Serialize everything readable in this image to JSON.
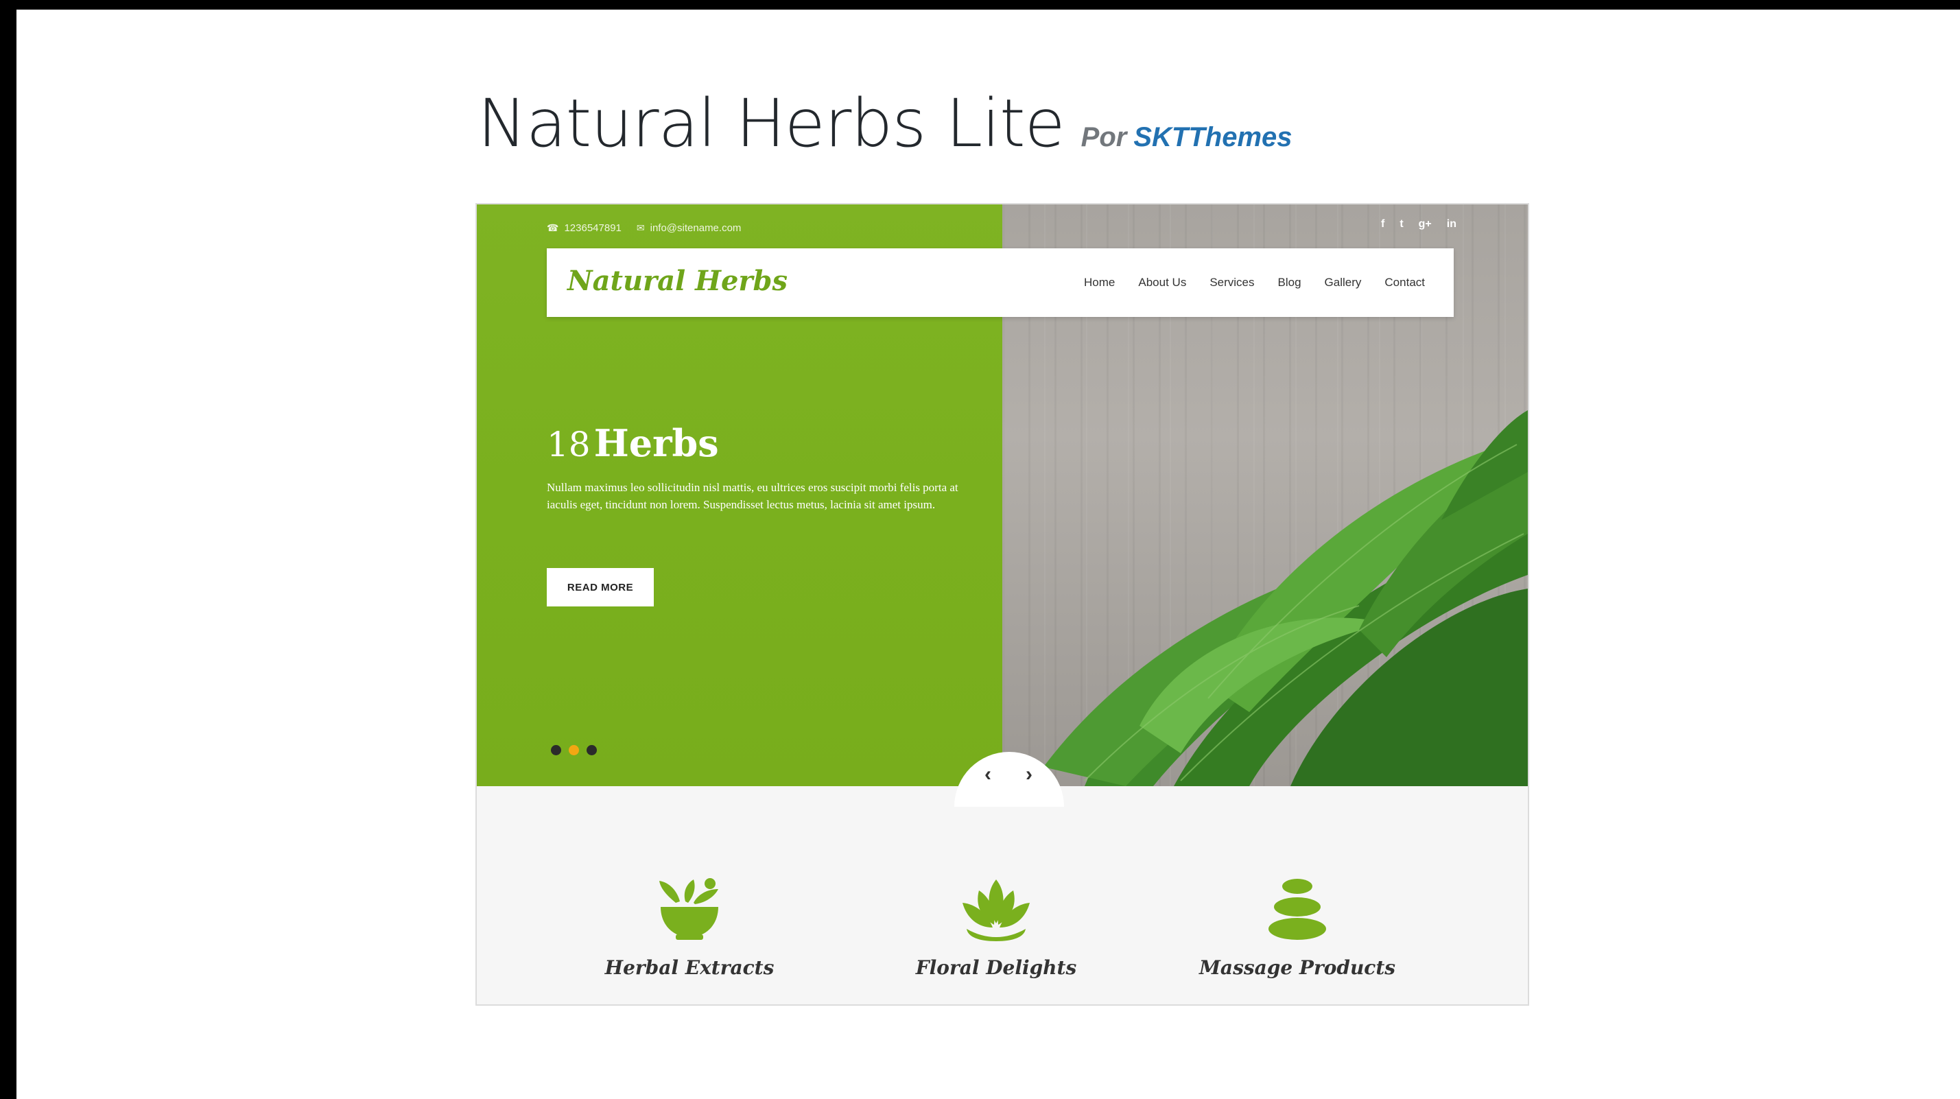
{
  "header": {
    "theme_name": "Natural Herbs Lite",
    "by_label": "Por",
    "author": "SKTThemes"
  },
  "preview": {
    "topbar": {
      "phone": "1236547891",
      "email": "info@sitename.com",
      "social_icons": [
        "facebook-icon",
        "twitter-icon",
        "google-plus-icon",
        "linkedin-icon"
      ],
      "social_glyphs": [
        "f",
        "t",
        "g+",
        "in"
      ]
    },
    "logo": "Natural Herbs",
    "menu": [
      "Home",
      "About Us",
      "Services",
      "Blog",
      "Gallery",
      "Contact"
    ],
    "hero": {
      "heading_number": "18",
      "heading_word": "Herbs",
      "text": "Nullam maximus leo sollicitudin nisl mattis, eu ultrices eros suscipit morbi felis porta at iaculis eget, tincidunt non lorem. Suspendisset lectus metus, lacinia sit amet ipsum.",
      "button": "READ MORE",
      "active_slide": 2,
      "slides": 3
    },
    "features": [
      {
        "label": "Herbal Extracts",
        "icon": "mortar-herbs-icon"
      },
      {
        "label": "Floral Delights",
        "icon": "lotus-icon"
      },
      {
        "label": "Massage Products",
        "icon": "stones-icon"
      }
    ],
    "colors": {
      "accent_green": "#7ab01e",
      "author_blue": "#2271b1",
      "active_dot": "#f2a713"
    }
  }
}
